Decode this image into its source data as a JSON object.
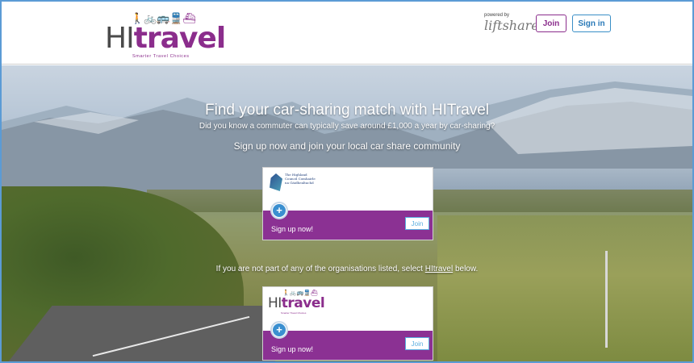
{
  "header": {
    "logo": {
      "hi": "HI",
      "travel": "travel",
      "tagline": "Smarter Travel Choices",
      "icons": [
        "walk-icon",
        "bike-icon",
        "bus-icon",
        "train-icon",
        "ferry-icon"
      ]
    },
    "powered_by": "powered by",
    "powered_brand": "liftshare",
    "join_label": "Join",
    "signin_label": "Sign in"
  },
  "hero": {
    "title": "Find your car-sharing match with HITravel",
    "subtitle": "Did you know a commuter can typically save around £1,000 a year by car-sharing?",
    "cta": "Sign up now and join your local car share community",
    "note_before": "If you are not part of any of the organisations listed, select ",
    "note_link": "HItravel",
    "note_after": " below."
  },
  "cards": [
    {
      "org_name": "The Highland Council Comhairle na Gàidhealtachd",
      "signup_label": "Sign up now!",
      "join_label": "Join"
    },
    {
      "logo_hi": "HI",
      "logo_travel": "travel",
      "logo_tagline": "Smarter Travel Choices",
      "signup_label": "Sign up now!",
      "join_label": "Join"
    }
  ],
  "colors": {
    "brand_purple": "#8b2d8c",
    "accent_blue": "#3a8fc7",
    "card_band": "#8b3193"
  }
}
